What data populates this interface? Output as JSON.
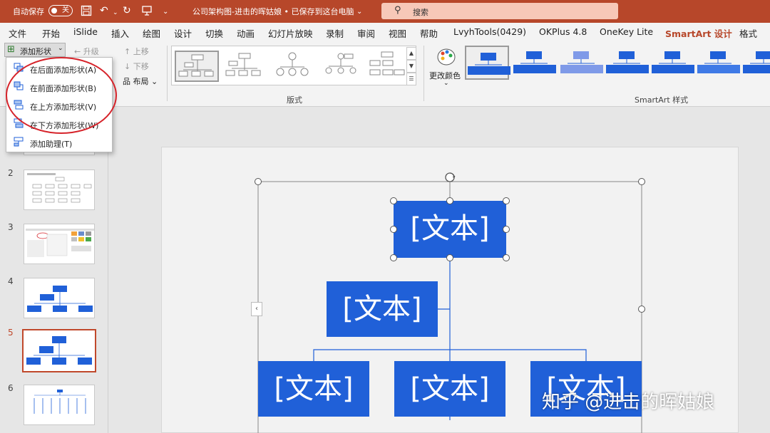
{
  "titlebar": {
    "autosave_label": "自动保存",
    "autosave_state": "关",
    "doc_title": "公司架构图-进击的晖姑娘 • 已保存到这台电脑",
    "search_placeholder": "搜索",
    "bg_color": "#b7472a"
  },
  "tabs": [
    "文件",
    "开始",
    "iSlide",
    "插入",
    "绘图",
    "设计",
    "切换",
    "动画",
    "幻灯片放映",
    "录制",
    "审阅",
    "视图",
    "帮助",
    "LvyhTools(0429)",
    "OKPlus 4.8",
    "OneKey Lite",
    "SmartArt 设计",
    "格式"
  ],
  "active_tab": "SmartArt 设计",
  "ribbon": {
    "add_shape": "添加形状",
    "promote": "升级",
    "demote": "下移",
    "move_down": "下移",
    "move_up": "上移",
    "layout": "布局",
    "layouts_group": "版式",
    "change_color": "更改颜色",
    "styles_group": "SmartArt 样式"
  },
  "add_shape_menu": [
    {
      "label": "在后面添加形状(A)",
      "icon": "add-after-icon"
    },
    {
      "label": "在前面添加形状(B)",
      "icon": "add-before-icon"
    },
    {
      "label": "在上方添加形状(V)",
      "icon": "add-above-icon"
    },
    {
      "label": "在下方添加形状(W)",
      "icon": "add-below-icon"
    },
    {
      "label": "添加助理(T)",
      "icon": "add-assistant-icon"
    }
  ],
  "slides": [
    "2",
    "3",
    "4",
    "5",
    "6"
  ],
  "selected_slide": "5",
  "smartart": {
    "top": "[文本]",
    "assistant": "[文本]",
    "child1": "[文本]",
    "child2": "[文本]",
    "child3": "[文本]",
    "box_color": "#2060d8"
  },
  "watermark": "知乎 @进击的晖姑娘"
}
